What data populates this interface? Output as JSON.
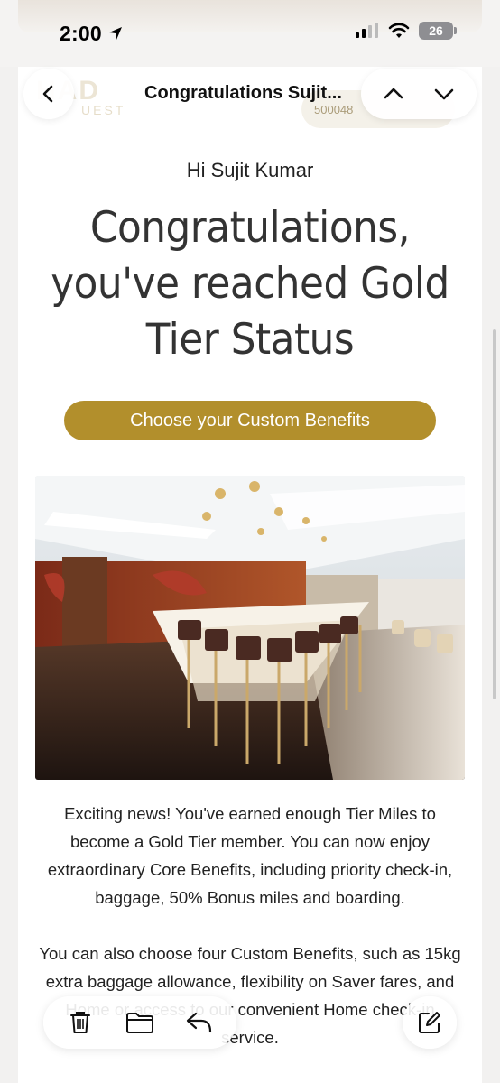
{
  "status_bar": {
    "time": "2:00",
    "battery": "26"
  },
  "header_ghost": {
    "brand": "HAD",
    "brand_sub": "UEST",
    "member_number": "500048"
  },
  "nav": {
    "title": "Congratulations Sujit..."
  },
  "email": {
    "greeting": "Hi Sujit Kumar",
    "headline": "Congratulations, you've reached Gold Tier Status",
    "cta_label": "Choose your Custom Benefits",
    "paragraph_1": "Exciting news! You've earned enough Tier Miles to become a Gold Tier member. You can now enjoy extraordinary Core Benefits, including priority check-in, baggage, 50% Bonus miles and boarding.",
    "paragraph_2": "You can also choose four Custom Benefits, such as 15kg extra baggage allowance, flexibility on Saver fares, and Home or access to our convenient Home check-in service."
  },
  "toolbar": {
    "icons": [
      "trash-icon",
      "folder-icon",
      "reply-icon",
      "compose-icon"
    ]
  },
  "colors": {
    "gold": "#b28f2c"
  }
}
